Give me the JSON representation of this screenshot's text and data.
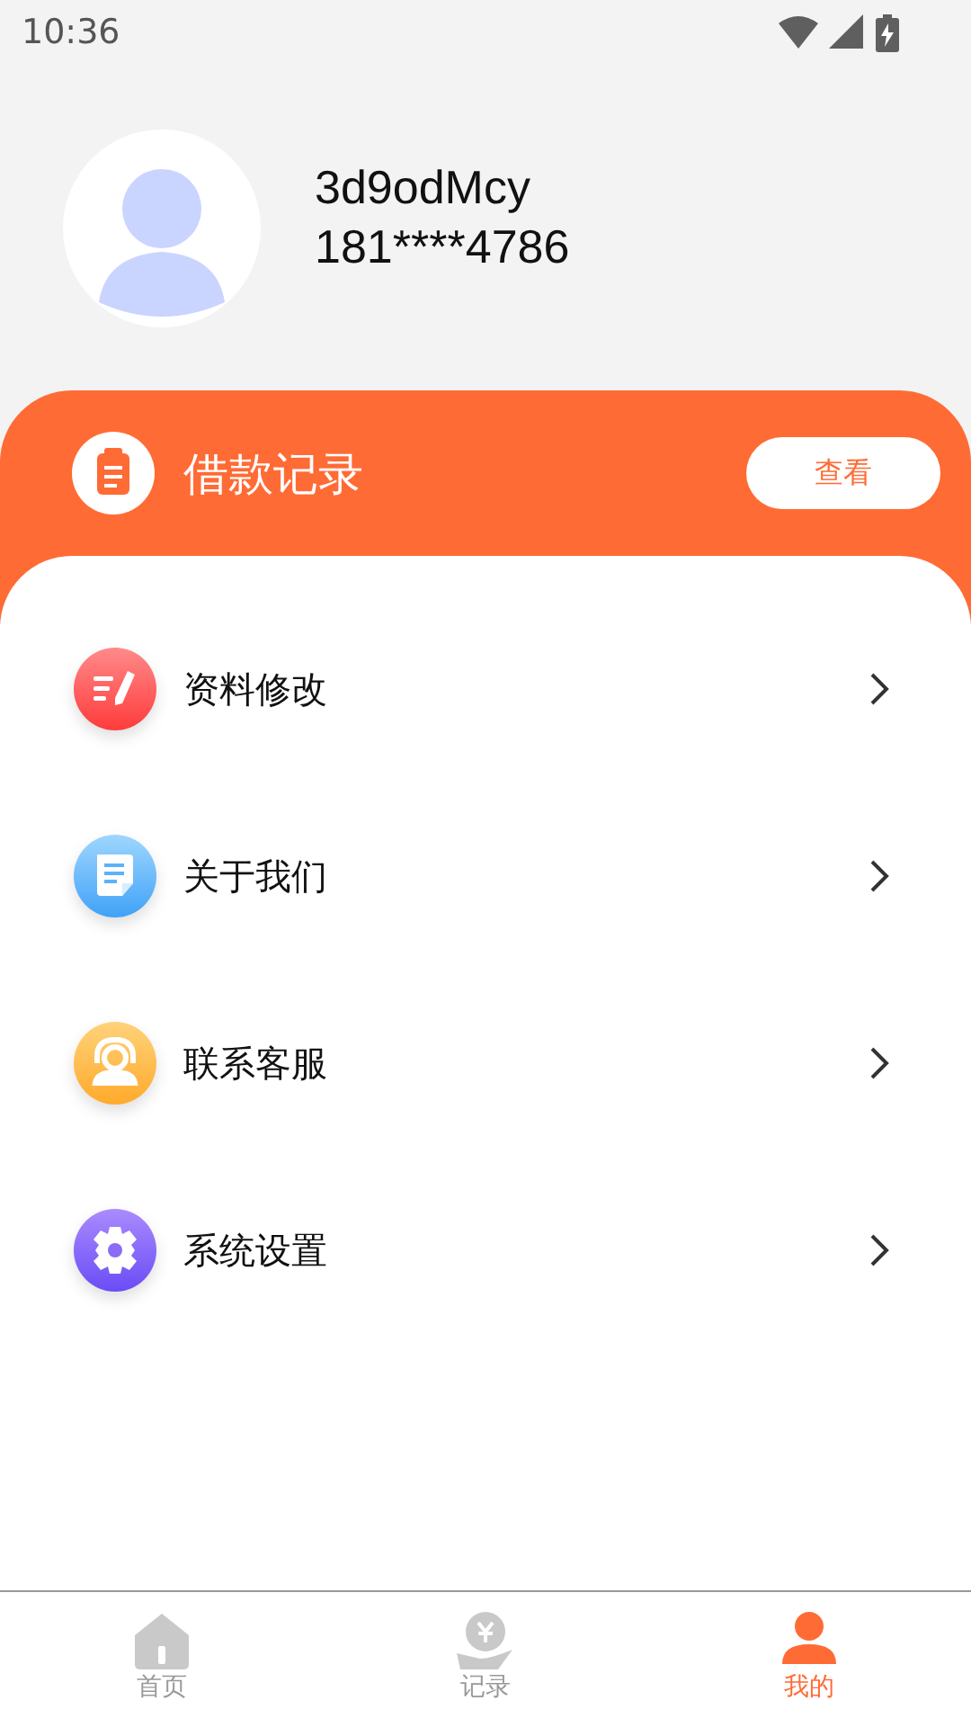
{
  "status_bar": {
    "time": "10:36"
  },
  "profile": {
    "username": "3d9odMcy",
    "phone": "181****4786"
  },
  "loan_card": {
    "title": "借款记录",
    "button": "查看"
  },
  "menu": [
    {
      "kind": "edit",
      "label": "资料修改"
    },
    {
      "kind": "doc",
      "label": "关于我们"
    },
    {
      "kind": "headset",
      "label": "联系客服"
    },
    {
      "kind": "gear",
      "label": "系统设置"
    }
  ],
  "tabs": [
    {
      "kind": "home",
      "label": "首页",
      "selected": false
    },
    {
      "kind": "records",
      "label": "记录",
      "selected": false
    },
    {
      "kind": "me",
      "label": "我的",
      "selected": true
    }
  ]
}
